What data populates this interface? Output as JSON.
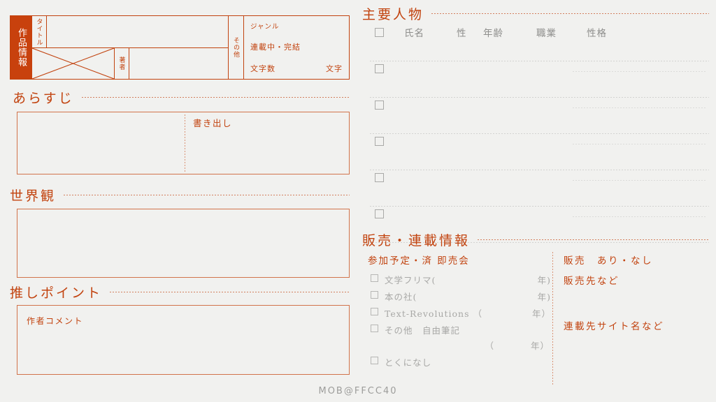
{
  "colors": {
    "accent": "#c2430f",
    "accent_fill": "#c8410d",
    "border_light": "#d1734b",
    "gray_text": "#8e8e8c",
    "gray_faint": "#a8a8a6",
    "background": "#f1f1ef"
  },
  "work_info": {
    "side_label": "作品情報",
    "title_label": "タイトル",
    "author_label": "著者",
    "other_label": "その他",
    "genre_label": "ジャンル",
    "serial_status": "連載中・完結",
    "char_count_label": "文字数",
    "char_count_unit": "文字"
  },
  "sections": {
    "arasuji": {
      "heading": "あらすじ",
      "inner_label": "書き出し"
    },
    "sekaikan": {
      "heading": "世界観"
    },
    "oshi_point": {
      "heading": "推しポイント",
      "inner_label": "作者コメント"
    },
    "characters": {
      "heading": "主要人物",
      "columns": [
        "氏名",
        "性",
        "年齢",
        "職業",
        "性格"
      ],
      "row_count": 6
    },
    "sales": {
      "heading": "販売・連載情報",
      "events_subheading": "参加予定・済 即売会",
      "events": [
        {
          "label": "文学フリマ(",
          "year": "年)"
        },
        {
          "label": "本の社(",
          "year": "年)"
        },
        {
          "label": "Text-Revolutions （",
          "year": "年）"
        },
        {
          "label": "その他　自由筆記",
          "year": ""
        },
        {
          "label": "とくになし",
          "year": ""
        }
      ],
      "event_extra_paren": "（",
      "event_extra_year": "年）",
      "sales_line": "販売　あり・なし",
      "sales_where": "販売先など",
      "serial_site": "連載先サイト名など"
    }
  },
  "footer": {
    "credit": "MOB@FFCC40"
  }
}
